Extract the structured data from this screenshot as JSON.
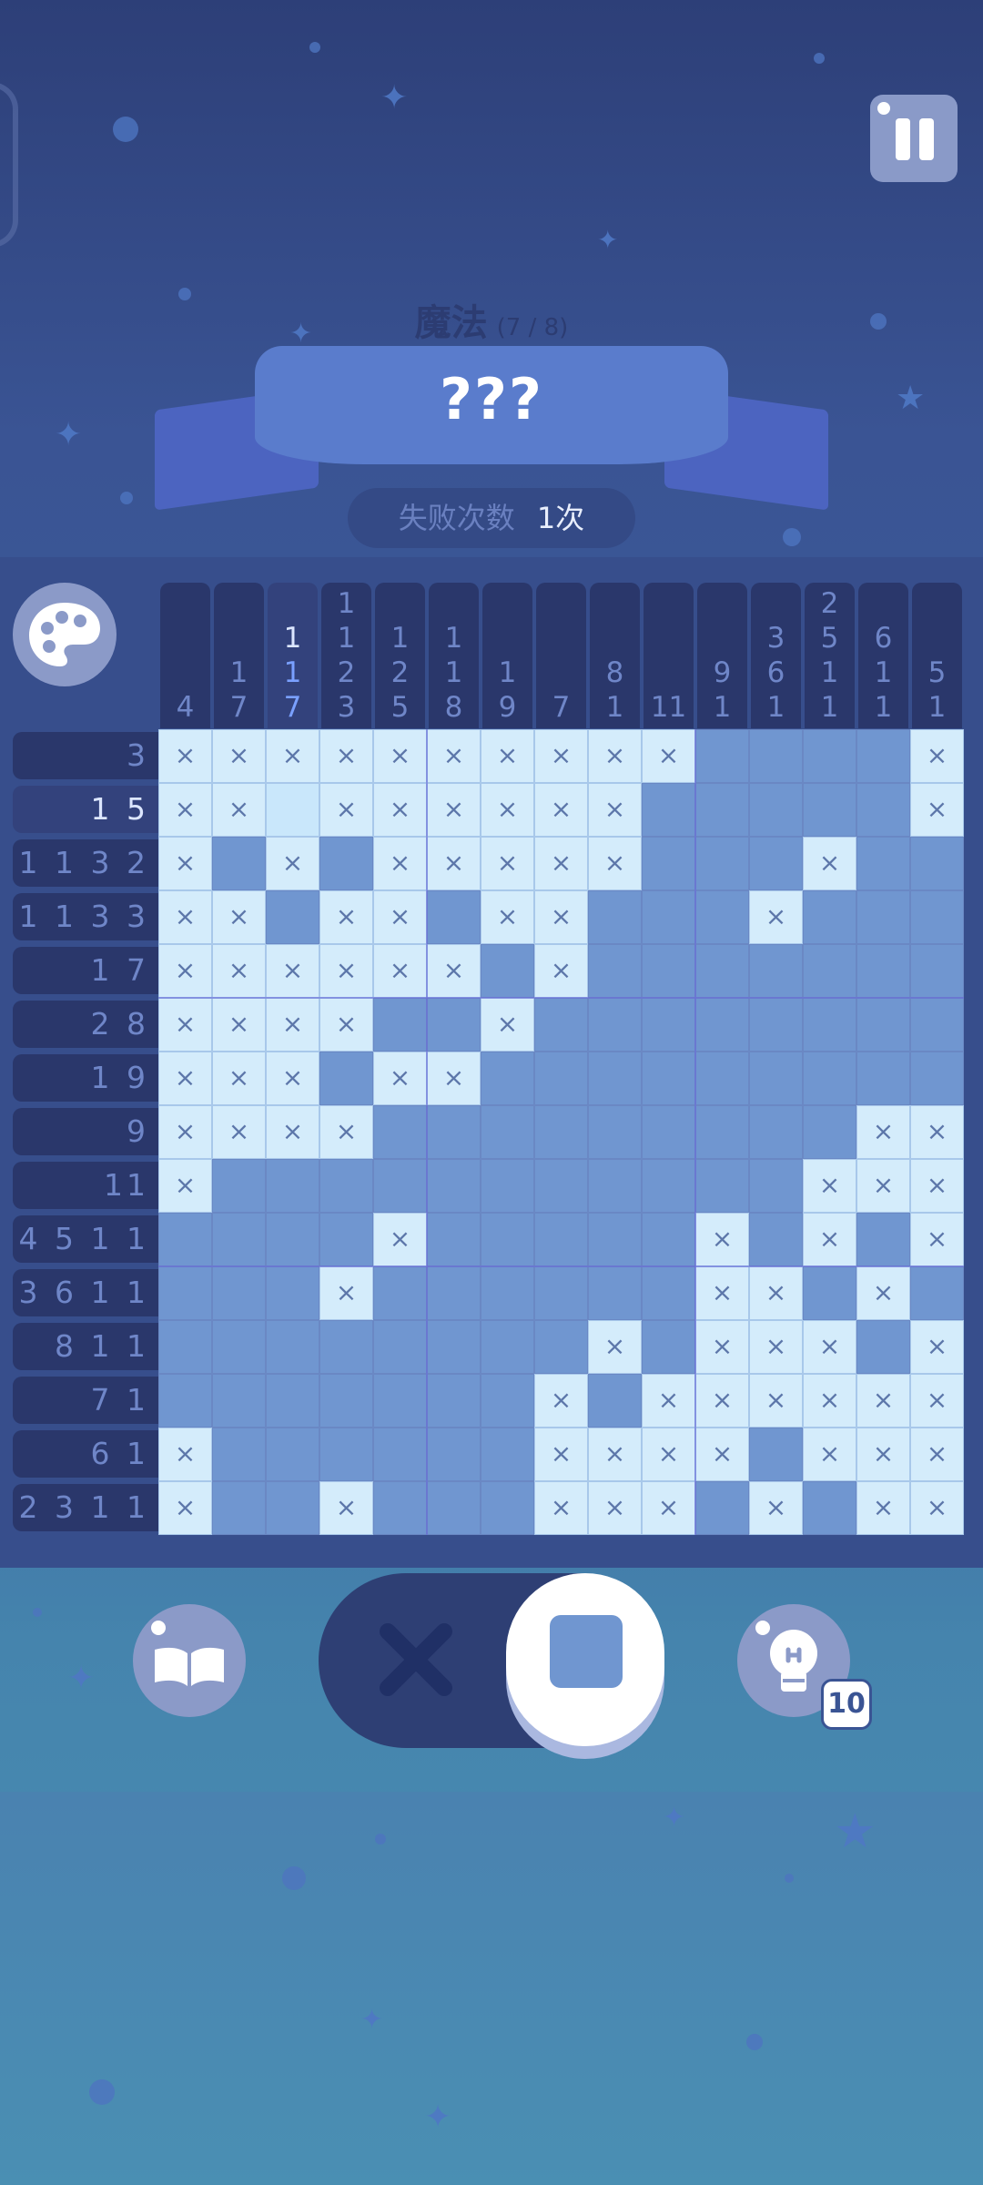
{
  "header": {
    "level_name": "魔法",
    "level_progress": "(7 / 8)",
    "puzzle_title": "???",
    "fail_label": "失败次数",
    "fail_count": "1次"
  },
  "column_clues": [
    [
      "4"
    ],
    [
      "1",
      "7"
    ],
    [
      "1",
      "1",
      "7"
    ],
    [
      "1",
      "1",
      "2",
      "3"
    ],
    [
      "1",
      "2",
      "5"
    ],
    [
      "1",
      "1",
      "8"
    ],
    [
      "1",
      "9"
    ],
    [
      "7"
    ],
    [
      "8",
      "1"
    ],
    [
      "11"
    ],
    [
      "9",
      "1"
    ],
    [
      "3",
      "6",
      "1"
    ],
    [
      "2",
      "5",
      "1",
      "1"
    ],
    [
      "6",
      "1",
      "1"
    ],
    [
      "5",
      "1"
    ]
  ],
  "row_clues": [
    "3",
    "1 5",
    "1 1 3 2",
    "1 1 3 3",
    "1 7",
    "2 8",
    "1 9",
    "9",
    "11",
    "4 5 1 1",
    "3 6 1 1",
    "8 1 1",
    "7 1",
    "6 1",
    "2 3 1 1"
  ],
  "grid_rows": [
    "xxxxxxxxxx fffxx",
    "xxexxxxxxfffffx",
    "xfxfxxxxxfffxff",
    "xxfxxfxxfffxfff",
    "xxxxxxfxfffffff",
    "xxxxffxffffffff",
    "xxxfxxfffffffff",
    "xxxxfffffffffxx",
    "xfffffffffffxxx",
    "ffffxfffffxfxfx",
    "fffxffffffxxfxf",
    "ffffffffxfxxxfx",
    "fffffffxfxxxxxx",
    "xffffffxxxxfxxx",
    "xffxfffxxxfxfxx"
  ],
  "controls": {
    "hint_count": "10",
    "cross_symbol": "✕",
    "mark_symbol": "×"
  },
  "colors": {
    "filled": "#7096d0",
    "crossed": "#d4ecfb",
    "clue_bg": "#2a376b"
  }
}
